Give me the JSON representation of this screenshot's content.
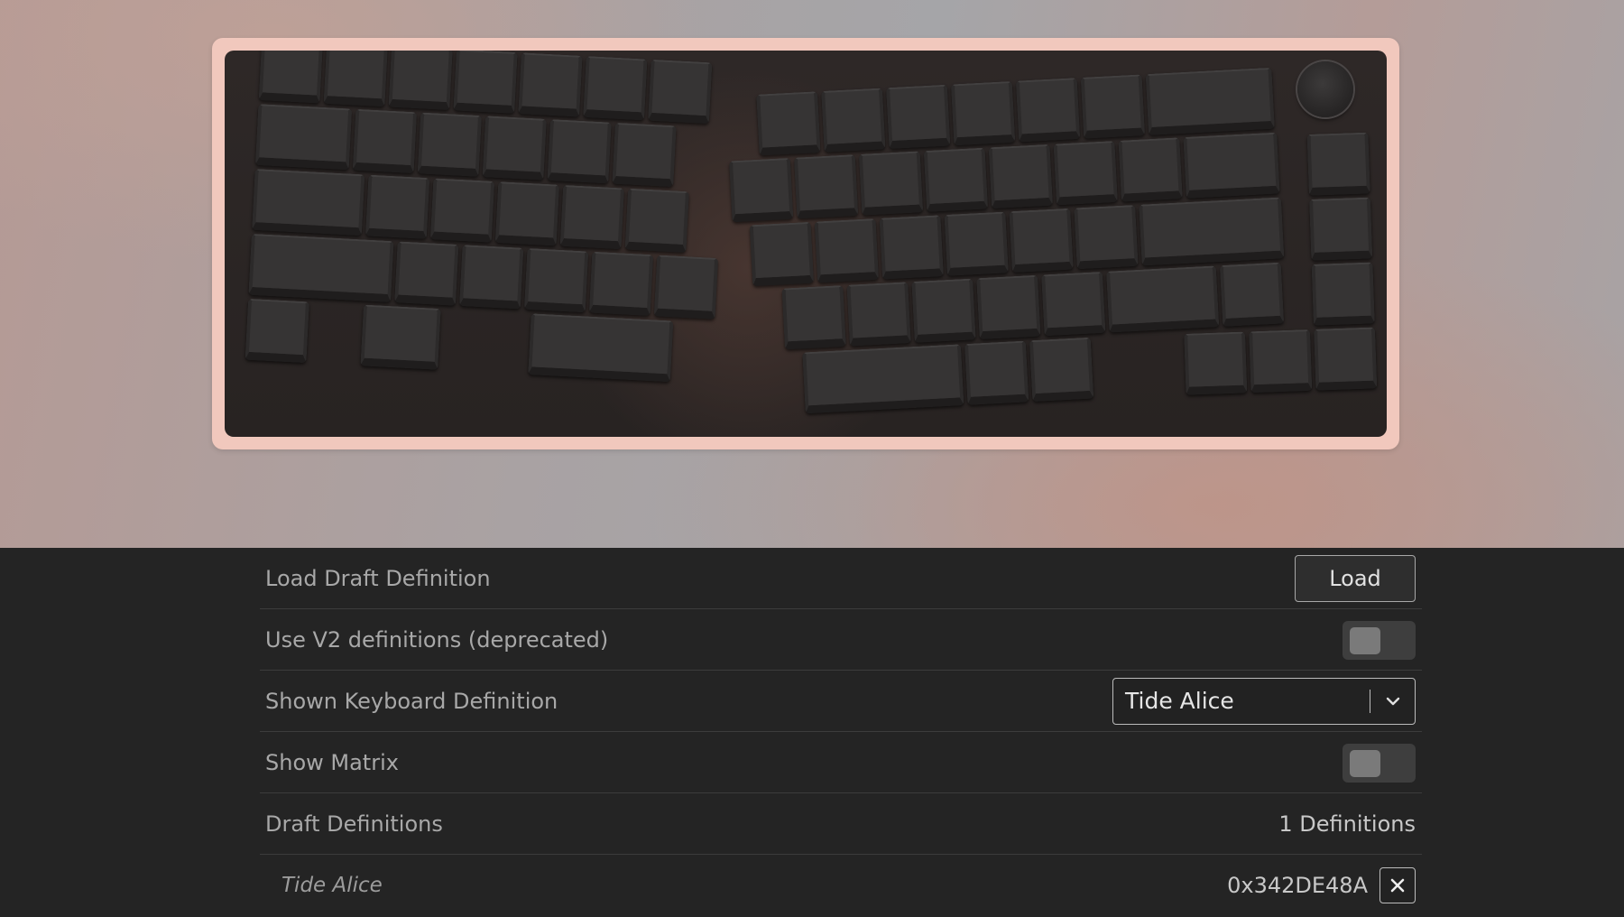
{
  "settings": {
    "load_draft": {
      "label": "Load Draft Definition",
      "button_label": "Load"
    },
    "use_v2": {
      "label": "Use V2 definitions (deprecated)",
      "enabled": false
    },
    "shown_keyboard": {
      "label": "Shown Keyboard Definition",
      "selected": "Tide Alice"
    },
    "show_matrix": {
      "label": "Show Matrix",
      "enabled": false
    },
    "draft_definitions": {
      "label": "Draft Definitions",
      "count_text": "1 Definitions",
      "items": [
        {
          "name": "Tide Alice",
          "id": "0x342DE48A"
        }
      ]
    }
  },
  "icons": {
    "chevron": "chevron-down-icon",
    "remove": "close-icon",
    "encoder": "rotary-encoder-knob"
  },
  "colors": {
    "case": "#f1c8bd",
    "plate": "#2a2524",
    "keycap": "#363434",
    "panel_background": "#242424",
    "label_text": "#a8a8a8"
  }
}
